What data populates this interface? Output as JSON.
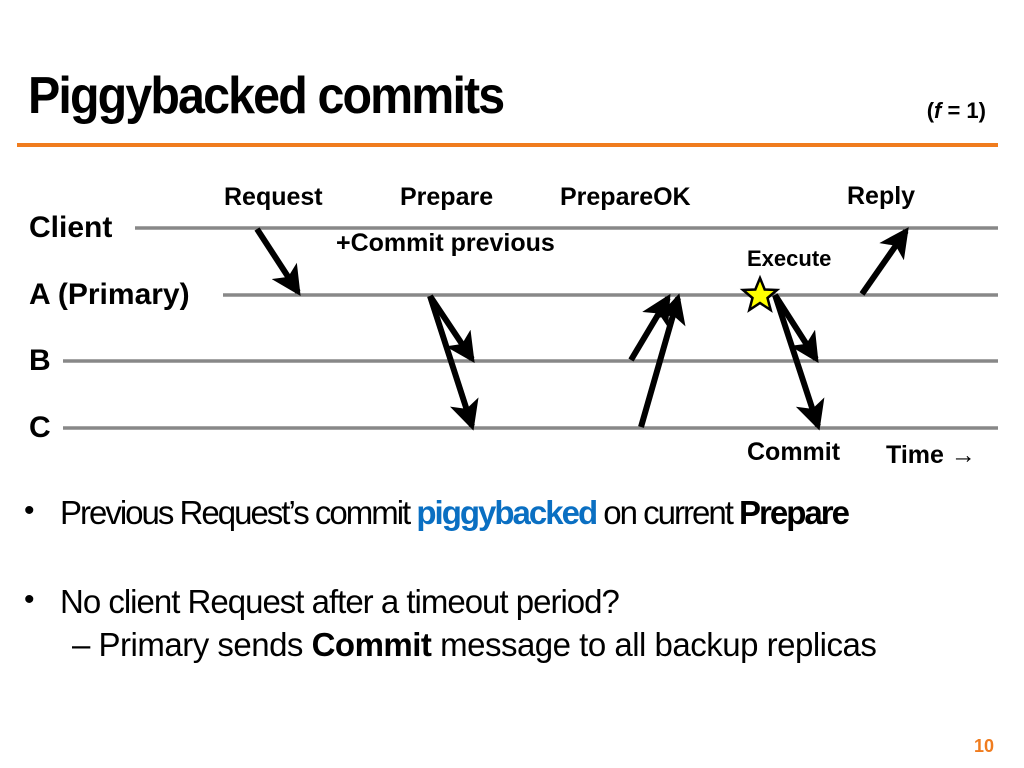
{
  "slide": {
    "title": "Piggybacked commits",
    "f_param": {
      "open": "(",
      "var": "f",
      "rest": " = 1)"
    },
    "page_number": "10",
    "colors": {
      "accent_orange": "#f07c1e",
      "highlight_blue": "#0a6fc2",
      "timeline_gray": "#888888",
      "star_fill": "#ffff00"
    }
  },
  "diagram": {
    "lanes": [
      "Client",
      "A (Primary)",
      "B",
      "C"
    ],
    "messages": [
      {
        "label": "Request",
        "from": "Client",
        "to": [
          "A (Primary)"
        ]
      },
      {
        "label": "Prepare",
        "sublabel": "+Commit previous",
        "from": "A (Primary)",
        "to": [
          "B",
          "C"
        ]
      },
      {
        "label": "PrepareOK",
        "from_lanes": [
          "B",
          "C"
        ],
        "to": "A (Primary)"
      },
      {
        "label": "Commit",
        "from": "A (Primary)",
        "to": [
          "B",
          "C"
        ]
      },
      {
        "label": "Reply",
        "from": "A (Primary)",
        "to": [
          "Client"
        ]
      }
    ],
    "event_label": "Execute",
    "event_icon": "star-icon",
    "time_label": "Time",
    "time_icon": "arrow-right-icon",
    "labels": {
      "request": "Request",
      "prepare": "Prepare",
      "commit_previous": "+Commit previous",
      "prepareok": "PrepareOK",
      "reply": "Reply",
      "execute": "Execute",
      "commit": "Commit",
      "time": "Time →"
    }
  },
  "bullets": [
    {
      "parts": [
        {
          "text": "Previous Request’s commit ",
          "style": "normal"
        },
        {
          "text": "piggybacked",
          "style": "blue-bold"
        },
        {
          "text": " on current ",
          "style": "normal"
        },
        {
          "text": "Prepare",
          "style": "bold"
        }
      ]
    },
    {
      "text": "No client Request after a timeout period?",
      "sub": {
        "dash": "– ",
        "parts": [
          {
            "text": "Primary sends ",
            "style": "normal"
          },
          {
            "text": "Commit",
            "style": "bold"
          },
          {
            "text": " message to all backup replicas",
            "style": "normal"
          }
        ]
      }
    }
  ]
}
